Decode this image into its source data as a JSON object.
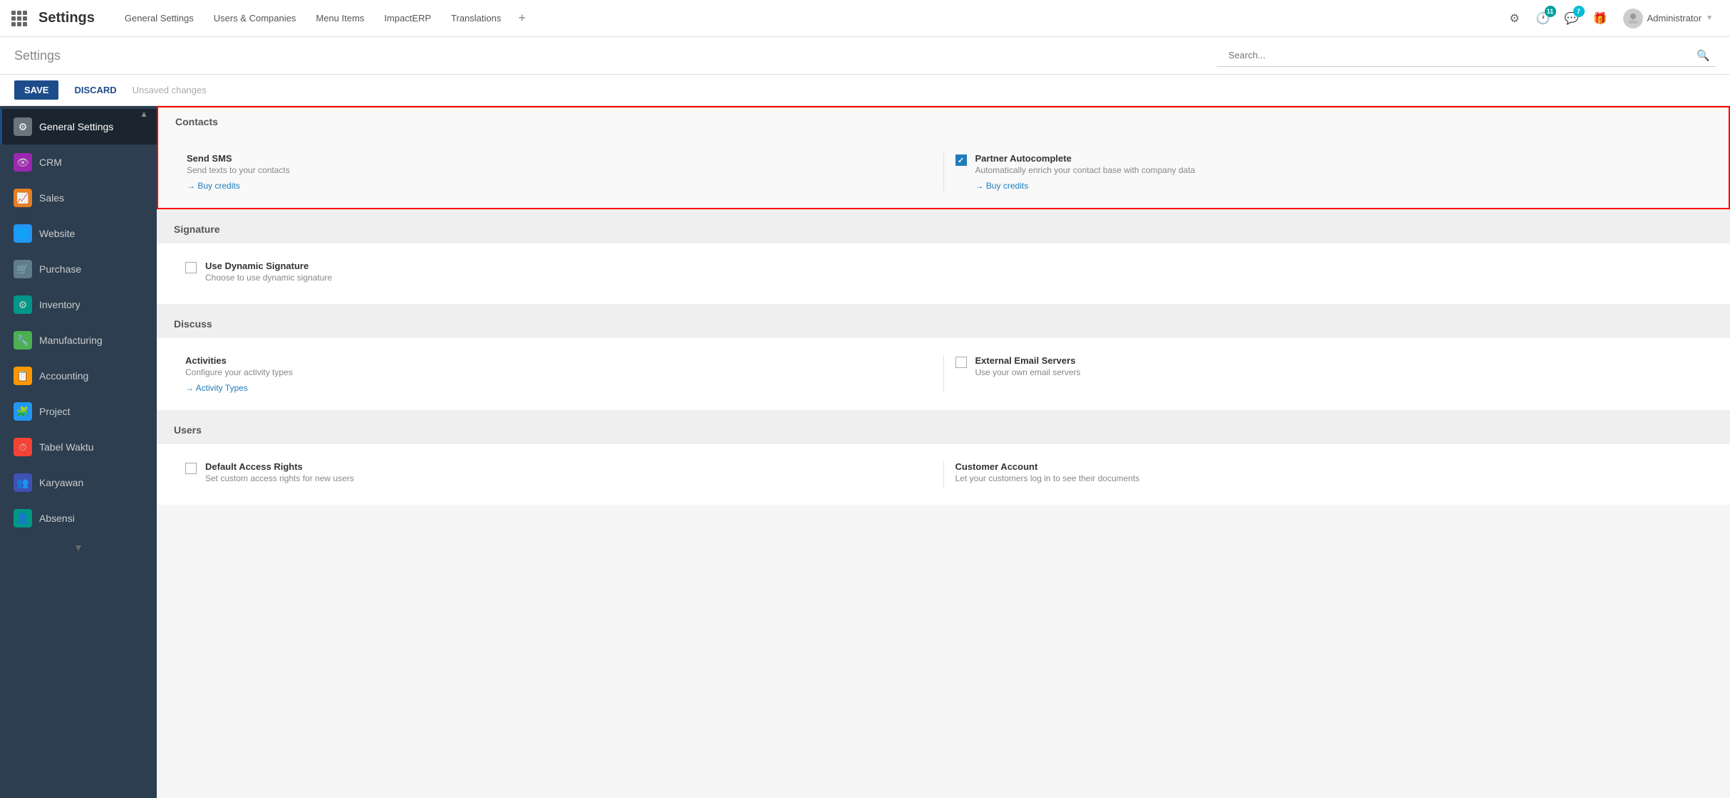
{
  "topNav": {
    "appTitle": "Settings",
    "menuItems": [
      {
        "label": "General Settings",
        "id": "general-settings"
      },
      {
        "label": "Users & Companies",
        "id": "users-companies"
      },
      {
        "label": "Menu Items",
        "id": "menu-items"
      },
      {
        "label": "ImpactERP",
        "id": "impacterp"
      },
      {
        "label": "Translations",
        "id": "translations"
      }
    ],
    "plusLabel": "+",
    "clockBadge": "11",
    "chatBadge": "7",
    "userName": "Administrator",
    "dropdownArrow": "▼"
  },
  "subHeader": {
    "title": "Settings",
    "searchPlaceholder": "Search..."
  },
  "actionBar": {
    "saveLabel": "SAVE",
    "discardLabel": "DISCARD",
    "unsavedLabel": "Unsaved changes"
  },
  "sidebar": {
    "items": [
      {
        "label": "General Settings",
        "icon": "⚙",
        "iconBg": "#6c757d",
        "id": "general-settings",
        "active": true
      },
      {
        "label": "CRM",
        "icon": "👁",
        "iconBg": "#9c27b0",
        "id": "crm"
      },
      {
        "label": "Sales",
        "icon": "📈",
        "iconBg": "#e67e22",
        "id": "sales"
      },
      {
        "label": "Website",
        "icon": "🌐",
        "iconBg": "#2196f3",
        "id": "website"
      },
      {
        "label": "Purchase",
        "icon": "🛒",
        "iconBg": "#607d8b",
        "id": "purchase"
      },
      {
        "label": "Inventory",
        "icon": "⚙",
        "iconBg": "#009688",
        "id": "inventory"
      },
      {
        "label": "Manufacturing",
        "icon": "🔧",
        "iconBg": "#4caf50",
        "id": "manufacturing"
      },
      {
        "label": "Accounting",
        "icon": "📋",
        "iconBg": "#ff9800",
        "id": "accounting"
      },
      {
        "label": "Project",
        "icon": "🧩",
        "iconBg": "#2196f3",
        "id": "project"
      },
      {
        "label": "Tabel Waktu",
        "icon": "⏱",
        "iconBg": "#f44336",
        "id": "tabel-waktu"
      },
      {
        "label": "Karyawan",
        "icon": "👥",
        "iconBg": "#3f51b5",
        "id": "karyawan"
      },
      {
        "label": "Absensi",
        "icon": "👤",
        "iconBg": "#009688",
        "id": "absensi"
      }
    ]
  },
  "content": {
    "contacts": {
      "sectionTitle": "Contacts",
      "highlighted": true,
      "sendSMS": {
        "title": "Send SMS",
        "desc": "Send texts to your contacts",
        "linkLabel": "→ Buy credits",
        "checked": false
      },
      "partnerAutocomplete": {
        "title": "Partner Autocomplete",
        "desc": "Automatically enrich your contact base with company data",
        "linkLabel": "→ Buy credits",
        "checked": true
      }
    },
    "signature": {
      "sectionTitle": "Signature",
      "useDynamic": {
        "title": "Use Dynamic Signature",
        "desc": "Choose to use dynamic signature",
        "checked": false
      }
    },
    "discuss": {
      "sectionTitle": "Discuss",
      "activities": {
        "title": "Activities",
        "desc": "Configure your activity types",
        "linkLabel": "→ Activity Types",
        "checked": false
      },
      "externalEmail": {
        "title": "External Email Servers",
        "desc": "Use your own email servers",
        "checked": false
      }
    },
    "users": {
      "sectionTitle": "Users",
      "defaultAccess": {
        "title": "Default Access Rights",
        "desc": "Set custom access rights for new users",
        "checked": false
      },
      "customerAccount": {
        "title": "Customer Account",
        "desc": "Let your customers log in to see their documents",
        "checked": false
      }
    }
  }
}
